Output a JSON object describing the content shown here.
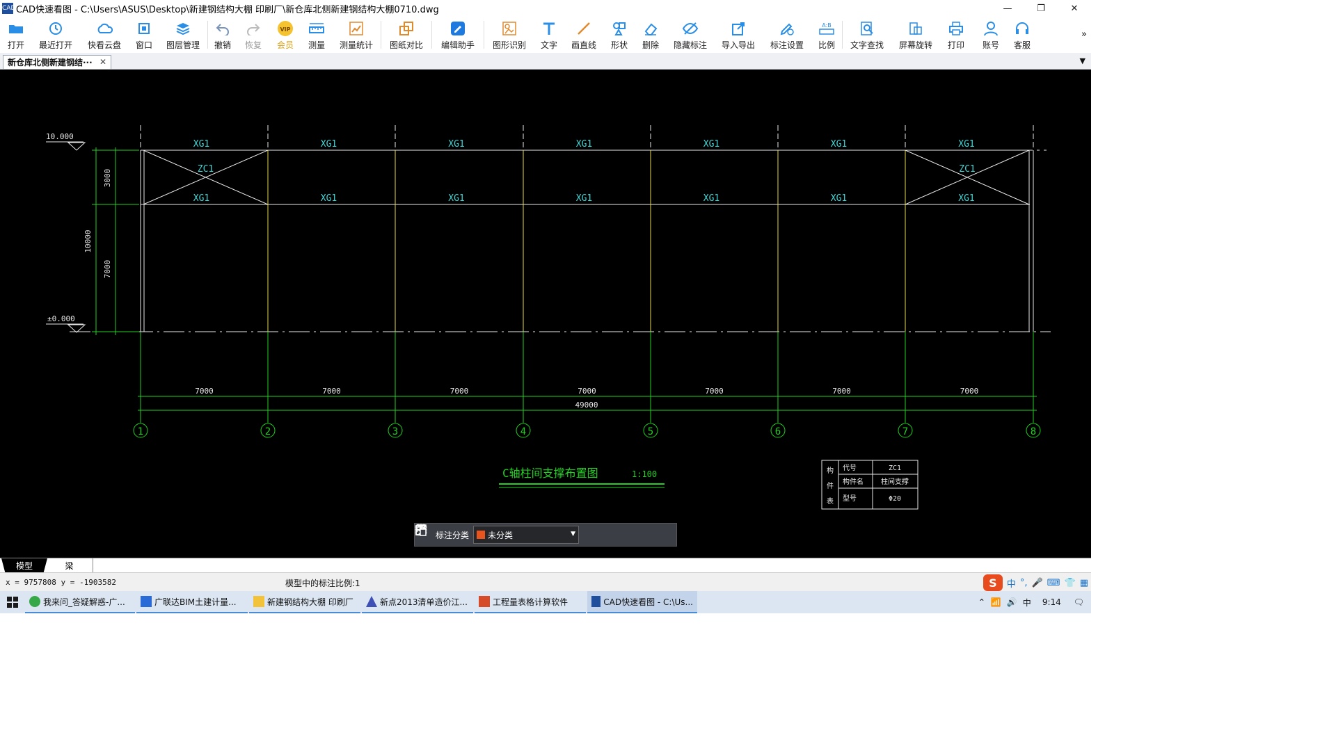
{
  "window": {
    "title": "CAD快速看图 - C:\\Users\\ASUS\\Desktop\\新建钢结构大棚 印刷厂\\新仓库北侧新建钢结构大棚0710.dwg",
    "app_icon_text": "CAD",
    "minimize": "—",
    "restore": "❐",
    "close": "✕"
  },
  "toolbar": {
    "items": [
      {
        "label": "打开",
        "icon": "folder-open-icon"
      },
      {
        "label": "最近打开",
        "icon": "history-icon"
      },
      {
        "label": "快看云盘",
        "icon": "cloud-icon"
      },
      {
        "label": "窗口",
        "icon": "window-icon"
      },
      {
        "label": "图层管理",
        "icon": "layers-icon"
      },
      {
        "label": "撤销",
        "icon": "undo-icon"
      },
      {
        "label": "恢复",
        "icon": "redo-icon"
      },
      {
        "label": "会员",
        "icon": "vip-icon"
      },
      {
        "label": "测量",
        "icon": "measure-icon"
      },
      {
        "label": "测量统计",
        "icon": "measure-stats-icon"
      },
      {
        "label": "图纸对比",
        "icon": "compare-icon"
      },
      {
        "label": "编辑助手",
        "icon": "edit-assistant-icon"
      },
      {
        "label": "图形识别",
        "icon": "shape-recognize-icon"
      },
      {
        "label": "文字",
        "icon": "text-icon"
      },
      {
        "label": "画直线",
        "icon": "line-icon"
      },
      {
        "label": "形状",
        "icon": "shapes-icon"
      },
      {
        "label": "删除",
        "icon": "eraser-icon"
      },
      {
        "label": "隐藏标注",
        "icon": "hide-annotation-icon"
      },
      {
        "label": "导入导出",
        "icon": "import-export-icon"
      },
      {
        "label": "标注设置",
        "icon": "annotation-settings-icon"
      },
      {
        "label": "比例",
        "icon": "scale-icon"
      },
      {
        "label": "文字查找",
        "icon": "text-search-icon"
      },
      {
        "label": "屏幕旋转",
        "icon": "rotate-screen-icon"
      },
      {
        "label": "打印",
        "icon": "print-icon"
      },
      {
        "label": "账号",
        "icon": "account-icon"
      },
      {
        "label": "客服",
        "icon": "headset-icon"
      }
    ],
    "more": "»"
  },
  "tabs": {
    "doc_tab": "新仓库北侧新建钢结···",
    "close": "✕",
    "dropdown": "▼"
  },
  "drawing": {
    "elevation_top": "10.000",
    "elevation_bottom": "±0.000",
    "dim_total_height": "10000",
    "dim_upper": "3000",
    "dim_lower": "7000",
    "beam_label": "XG1",
    "brace_label": "ZC1",
    "bay_dimension": "7000",
    "total_length": "49000",
    "axis_labels": [
      "1",
      "2",
      "3",
      "4",
      "5",
      "6",
      "7",
      "8"
    ],
    "drawing_title": "C轴柱间支撑布置图",
    "drawing_scale": "1:100",
    "member_table": {
      "side_label": [
        "构",
        "件",
        "表"
      ],
      "rows": [
        {
          "key": "代号",
          "value": "ZC1"
        },
        {
          "key": "构件名",
          "value": "柱间支撑"
        },
        {
          "key": "型号",
          "value": "Φ20"
        }
      ]
    }
  },
  "annotation_bar": {
    "label": "标注分类",
    "selected": "未分类",
    "swatch_color": "#e8541e"
  },
  "layout_tabs": [
    "模型",
    "梁"
  ],
  "status": {
    "coords": "x = 9757808  y = -1903582",
    "scale_text": "模型中的标注比例:1"
  },
  "ime": {
    "logo": "S",
    "lang": "中"
  },
  "taskbar": {
    "items": [
      "我来问_答疑解惑-广...",
      "广联达BIM土建计量...",
      "新建钢结构大棚 印刷厂",
      "新点2013清单造价江...",
      "工程量表格计算软件",
      "CAD快速看图 - C:\\Us..."
    ],
    "clock": "9:14",
    "tray_lang": "中"
  }
}
